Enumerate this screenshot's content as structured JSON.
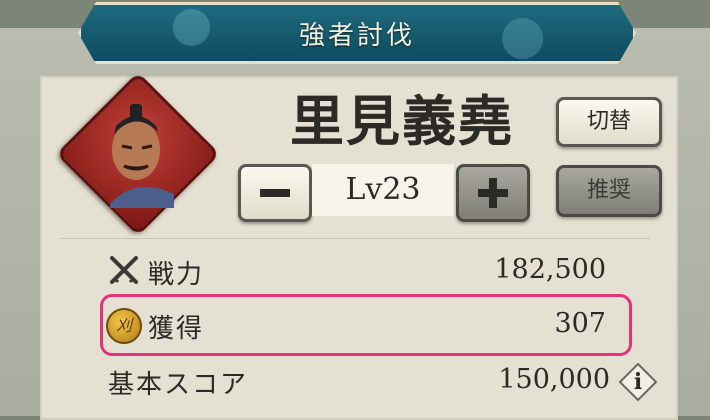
{
  "header": {
    "title": "強者討伐"
  },
  "general": {
    "name": "里見義堯",
    "level": "Lv23"
  },
  "buttons": {
    "switch_label": "切替",
    "recommend_label": "推奨",
    "minus": "−",
    "plus": "+"
  },
  "stats": [
    {
      "label": "戦力",
      "value": "182,500",
      "icon": "crossed-swords-icon"
    },
    {
      "label": "獲得",
      "value": "307",
      "icon": "gold-coin-icon",
      "highlighted": true
    },
    {
      "label": "基本スコア",
      "value": "150,000",
      "icon": "info-icon"
    }
  ],
  "coin_glyph": "刈",
  "info_glyph": "i",
  "colors": {
    "highlight": "#e8317a",
    "header": "#1f6b7f",
    "portrait_frame": "#9b221c"
  }
}
